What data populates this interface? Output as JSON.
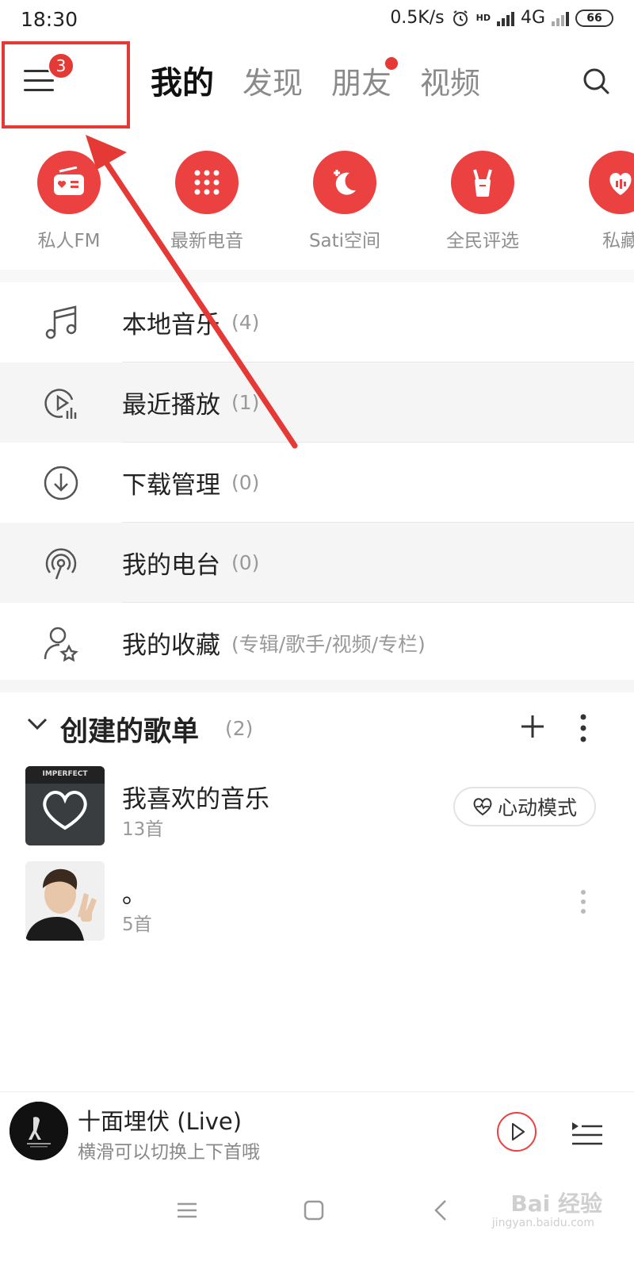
{
  "status_bar": {
    "time": "18:30",
    "net_speed": "0.5K/s",
    "network": "4G",
    "battery": "66",
    "hd_label": "HD"
  },
  "top_bar": {
    "menu_badge": "3",
    "tabs": [
      {
        "label": "我的",
        "active": true
      },
      {
        "label": "发现",
        "active": false
      },
      {
        "label": "朋友",
        "active": false,
        "dot": true
      },
      {
        "label": "视频",
        "active": false
      }
    ]
  },
  "quick_icons": [
    {
      "label": "私人FM",
      "icon": "radio-heart-icon"
    },
    {
      "label": "最新电音",
      "icon": "dots-grid-icon"
    },
    {
      "label": "Sati空间",
      "icon": "moon-icon"
    },
    {
      "label": "全民评选",
      "icon": "rock-hand-icon"
    },
    {
      "label": "私藏",
      "icon": "heart-chat-icon"
    }
  ],
  "list": [
    {
      "label": "本地音乐",
      "count": "(4)",
      "icon": "music-note-icon"
    },
    {
      "label": "最近播放",
      "count": "(1)",
      "icon": "recent-play-icon"
    },
    {
      "label": "下载管理",
      "count": "(0)",
      "icon": "download-icon"
    },
    {
      "label": "我的电台",
      "count": "(0)",
      "icon": "radio-station-icon"
    },
    {
      "label": "我的收藏",
      "count": "(专辑/歌手/视频/专栏)",
      "icon": "user-star-icon"
    }
  ],
  "playlists_section": {
    "title": "创建的歌单",
    "count": "(2)",
    "items": [
      {
        "name": "我喜欢的音乐",
        "sub": "13首",
        "cover_text": "IMPERFECT",
        "action": "心动模式"
      },
      {
        "name": "。",
        "sub": "5首"
      }
    ]
  },
  "player": {
    "title": "十面埋伏 (Live)",
    "subtitle": "横滑可以切换上下首哦"
  },
  "watermark": {
    "brand": "Bai 经验",
    "url": "jingyan.baidu.com"
  },
  "colors": {
    "accent": "#ec4141",
    "annotation": "#e53935"
  }
}
